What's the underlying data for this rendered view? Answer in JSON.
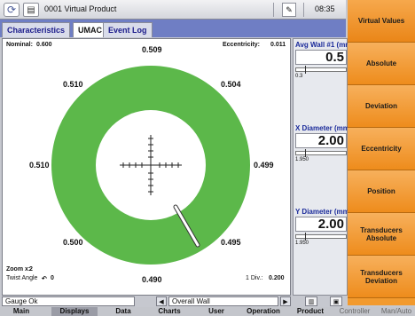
{
  "topbar": {
    "title": "0001 Virtual Product",
    "time": "08:35"
  },
  "tabs": [
    "Characteristics",
    "UMAC",
    "Event Log"
  ],
  "plot": {
    "nominal_label": "Nominal:",
    "nominal_value": "0.600",
    "eccentricity_label": "Eccentricity:",
    "eccentricity_value": "0.011",
    "values": {
      "top": "0.509",
      "top_left": "0.510",
      "top_right": "0.504",
      "left": "0.510",
      "right": "0.499",
      "bottom_left": "0.500",
      "bottom_right": "0.495",
      "bottom": "0.490"
    },
    "zoom_label": "Zoom x:",
    "zoom_value": "2",
    "twist_label": "Twist Angle",
    "twist_value": "0",
    "div_label": "1 Div.:",
    "div_value": "0.200",
    "ring_color": "#5cb84a"
  },
  "readings": [
    {
      "title": "Avg Wall #1 (mm)",
      "value": "0.5",
      "min": "0.3"
    },
    {
      "title": "X Diameter (mm)",
      "value": "2.00",
      "min": "1.950"
    },
    {
      "title": "Y Diameter (mm)",
      "value": "2.00",
      "min": "1.950"
    }
  ],
  "sidemenu": [
    "Virtual Values",
    "Absolute",
    "Deviation",
    "Eccentricity",
    "Position",
    "Transducers Absolute",
    "Transducers Deviation"
  ],
  "status": {
    "text": "Gauge Ok",
    "selection": "Overall Wall"
  },
  "bottomnav": [
    "Main",
    "Displays",
    "Data",
    "Charts",
    "User",
    "Operation",
    "Product",
    "Controller",
    "Man/Auto"
  ]
}
